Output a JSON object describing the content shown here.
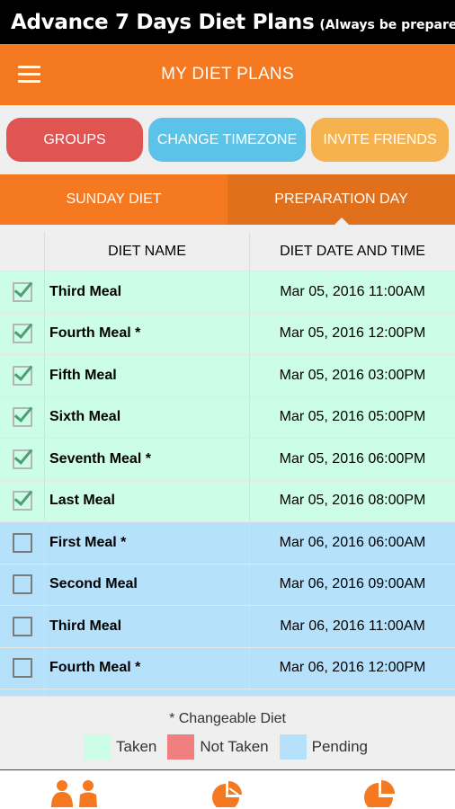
{
  "app_title": {
    "main": "Advance 7 Days Diet Plans",
    "sub": "(Always be prepared)"
  },
  "toolbar": {
    "title": "MY DIET PLANS",
    "menu_icon": "hamburger-menu-icon"
  },
  "buttons": {
    "groups": "GROUPS",
    "change_timezone": "CHANGE TIMEZONE",
    "invite_friends": "INVITE FRIENDS"
  },
  "tabs": [
    {
      "label": "SUNDAY DIET"
    },
    {
      "label": "PREPARATION DAY"
    }
  ],
  "table": {
    "headers": {
      "name": "DIET NAME",
      "date": "DIET DATE AND TIME"
    },
    "rows": [
      {
        "name": "Third Meal",
        "date": "Mar 05, 2016 11:00AM",
        "status": "taken",
        "checked": true
      },
      {
        "name": "Fourth Meal *",
        "date": "Mar 05, 2016 12:00PM",
        "status": "taken",
        "checked": true
      },
      {
        "name": "Fifth Meal",
        "date": "Mar 05, 2016 03:00PM",
        "status": "taken",
        "checked": true
      },
      {
        "name": "Sixth Meal",
        "date": "Mar 05, 2016 05:00PM",
        "status": "taken",
        "checked": true
      },
      {
        "name": "Seventh Meal *",
        "date": "Mar 05, 2016 06:00PM",
        "status": "taken",
        "checked": true
      },
      {
        "name": "Last Meal",
        "date": "Mar 05, 2016 08:00PM",
        "status": "taken",
        "checked": true
      },
      {
        "name": "First Meal *",
        "date": "Mar 06, 2016 06:00AM",
        "status": "pending",
        "checked": false
      },
      {
        "name": "Second Meal",
        "date": "Mar 06, 2016 09:00AM",
        "status": "pending",
        "checked": false
      },
      {
        "name": "Third Meal",
        "date": "Mar 06, 2016 11:00AM",
        "status": "pending",
        "checked": false
      },
      {
        "name": "Fourth Meal *",
        "date": "Mar 06, 2016 12:00PM",
        "status": "pending",
        "checked": false
      },
      {
        "name": "",
        "date": "",
        "status": "pending",
        "checked": false
      }
    ]
  },
  "footer": {
    "note": "* Changeable Diet",
    "legend": [
      {
        "label": "Taken",
        "color": "#ccfde6"
      },
      {
        "label": "Not Taken",
        "color": "#f08080"
      },
      {
        "label": "Pending",
        "color": "#b6e1fb"
      }
    ]
  },
  "colors": {
    "accent": "#f47920",
    "groups": "#e05551",
    "timezone": "#5cc3e8",
    "invite": "#f5b24f",
    "icon": "#f47920"
  },
  "bottom_nav": [
    {
      "icon": "people-icon"
    },
    {
      "icon": "pie-chart-icon"
    },
    {
      "icon": "pie-chart-icon"
    }
  ]
}
